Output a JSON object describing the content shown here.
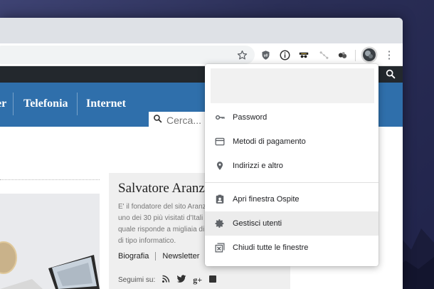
{
  "browser": {
    "extensions": [
      "ublock-icon",
      "info-icon",
      "incognito-icon",
      "network-icon",
      "puzzle-dots-icon"
    ],
    "menu_glyph": "⋮"
  },
  "site": {
    "nav": [
      {
        "label": "er"
      },
      {
        "label": "Telefonia"
      },
      {
        "label": "Internet"
      }
    ],
    "search_placeholder": "Cerca...",
    "author": {
      "name": "Salvatore Aranz",
      "bio_lines": [
        "E' il fondatore del sito Aranz",
        "uno dei 30 più visitati d'Itali",
        "quale risponde a migliaia di",
        "di tipo informatico."
      ],
      "links": [
        "Biografia",
        "Newsletter"
      ],
      "follow_label": "Seguimi su:",
      "social_plus": "g+"
    }
  },
  "profile_menu": {
    "items": [
      {
        "label": "Password",
        "icon": "key-icon"
      },
      {
        "label": "Metodi di pagamento",
        "icon": "credit-card-icon"
      },
      {
        "label": "Indirizzi e altro",
        "icon": "location-pin-icon"
      },
      {
        "label": "Apri finestra Ospite",
        "icon": "guest-badge-icon"
      },
      {
        "label": "Gestisci utenti",
        "icon": "gear-icon",
        "highlighted": true
      },
      {
        "label": "Chiudi tutte le finestre",
        "icon": "close-windows-icon"
      }
    ]
  },
  "colors": {
    "site_nav": "#2f6fab",
    "site_topbar": "#23282d",
    "desktop": "#2b2f57",
    "menu_hover": "#ececec"
  }
}
